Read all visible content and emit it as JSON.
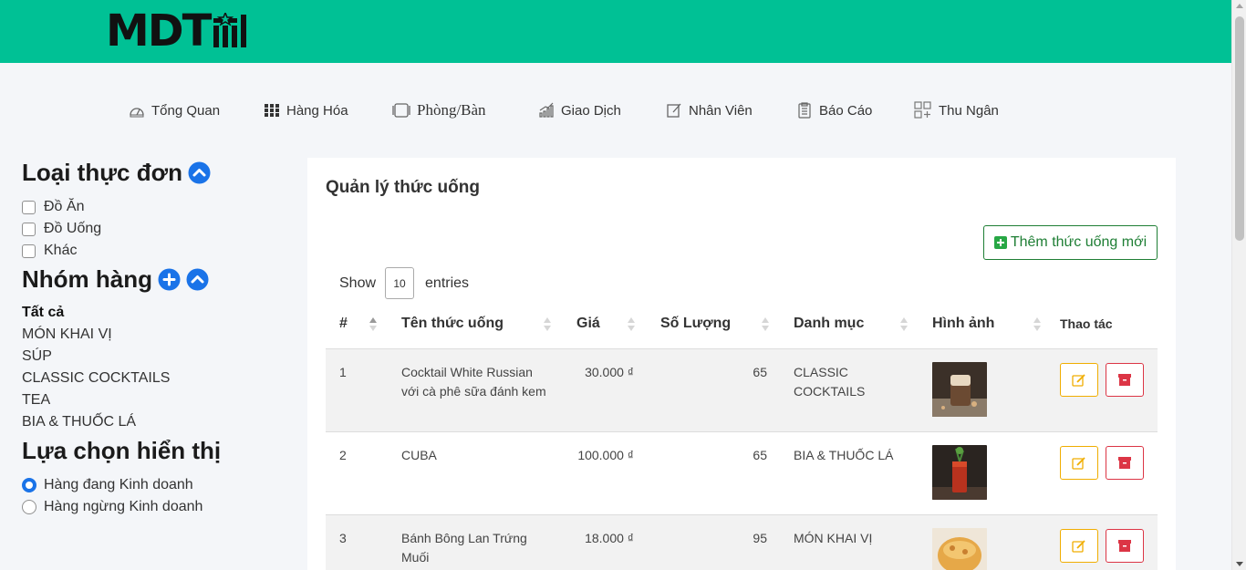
{
  "brand": {
    "logo_text": "MDT",
    "header_color": "#00c195"
  },
  "nav": {
    "items": [
      {
        "label": "Tổng Quan",
        "icon": "dashboard-icon"
      },
      {
        "label": "Hàng Hóa",
        "icon": "grid-icon"
      },
      {
        "label": "Phòng/Bàn",
        "icon": "table-icon"
      },
      {
        "label": "Giao Dịch",
        "icon": "chart-icon"
      },
      {
        "label": "Nhân Viên",
        "icon": "edit-icon"
      },
      {
        "label": "Báo Cáo",
        "icon": "report-icon"
      },
      {
        "label": "Thu Ngân",
        "icon": "cashier-icon"
      }
    ]
  },
  "sidebar": {
    "menu_type_title": "Loại thực đơn",
    "menu_types": [
      "Đồ Ăn",
      "Đồ Uống",
      "Khác"
    ],
    "group_title": "Nhóm hàng",
    "groups": [
      "Tất cả",
      "MÓN KHAI VỊ",
      "SÚP",
      "CLASSIC COCKTAILS",
      "TEA",
      "BIA & THUỐC LÁ"
    ],
    "display_title": "Lựa chọn hiển thị",
    "display_options": [
      "Hàng đang Kinh doanh",
      "Hàng ngừng Kinh doanh"
    ],
    "display_selected": 0
  },
  "panel": {
    "title": "Quản lý thức uống",
    "add_button": "Thêm thức uống mới",
    "show_label": "Show",
    "show_value": "10",
    "entries_label": "entries"
  },
  "table": {
    "headers": [
      "#",
      "Tên thức uống",
      "Giá",
      "Số Lượng",
      "Danh mục",
      "Hình ảnh",
      "Thao tác"
    ],
    "rows": [
      {
        "index": "1",
        "name_line1": "Cocktail White Russian",
        "name_line2": "với cà phê sữa đánh kem",
        "price": "30.000 ₫",
        "qty": "65",
        "cat_line1": "CLASSIC",
        "cat_line2": "COCKTAILS"
      },
      {
        "index": "2",
        "name_line1": "CUBA",
        "name_line2": "",
        "price": "100.000 ₫",
        "qty": "65",
        "cat_line1": "BIA & THUỐC LÁ",
        "cat_line2": ""
      },
      {
        "index": "3",
        "name_line1": "Bánh Bông Lan Trứng",
        "name_line2": "Muối",
        "price": "18.000 ₫",
        "qty": "95",
        "cat_line1": "MÓN KHAI VỊ",
        "cat_line2": ""
      }
    ]
  },
  "colors": {
    "accent_blue": "#1a73e8",
    "edit": "#f0ad00",
    "delete": "#dc3545",
    "add": "#1e7e34"
  }
}
